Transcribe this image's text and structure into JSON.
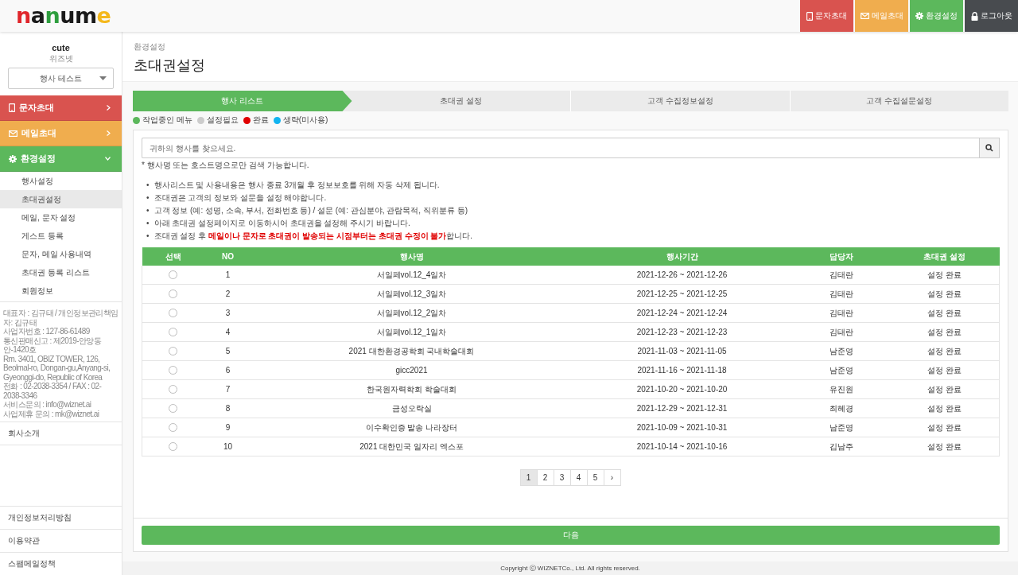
{
  "logo": {
    "letters": [
      {
        "text": "n",
        "color": "#e0262b"
      },
      {
        "text": "a",
        "color": "#1a1a1a"
      },
      {
        "text": "n",
        "color": "#2e9e3e"
      },
      {
        "text": "u",
        "color": "#1a1a1a"
      },
      {
        "text": "m",
        "color": "#1a1a1a"
      },
      {
        "text": "e",
        "color": "#f4b81c"
      }
    ]
  },
  "top_buttons": [
    {
      "label": "문자초대",
      "kind": "sms",
      "color": "#d9534f"
    },
    {
      "label": "메일초대",
      "kind": "mail",
      "color": "#f0ad4e"
    },
    {
      "label": "환경설정",
      "kind": "settings",
      "color": "#5cb85c"
    },
    {
      "label": "로그아웃",
      "kind": "logout",
      "color": "#484b4f"
    }
  ],
  "sidebar": {
    "user": "cute",
    "company": "위즈넷",
    "event_select": "행사 테스트",
    "menus": [
      {
        "label": "문자초대",
        "kind": "sms",
        "color": "#d9534f",
        "expanded": false
      },
      {
        "label": "메일초대",
        "kind": "mail",
        "color": "#f0ad4e",
        "expanded": false
      },
      {
        "label": "환경설정",
        "kind": "settings",
        "color": "#5cb85c",
        "expanded": true,
        "children": [
          {
            "label": "행사설정",
            "selected": false
          },
          {
            "label": "초대권설정",
            "selected": true
          },
          {
            "label": "메일, 문자 설정",
            "selected": false
          },
          {
            "label": "게스트 등록",
            "selected": false
          },
          {
            "label": "문자, 메일 사용내역",
            "selected": false
          },
          {
            "label": "초대권 등록 리스트",
            "selected": false
          },
          {
            "label": "회원정보",
            "selected": false
          }
        ]
      }
    ],
    "company_info": [
      "대표자 : 김규태 / 개인정보관리책임자: 김규태",
      "사업자번호 : 127-86-61489",
      "통신판매신고 : 제2019-안양동안-1420호",
      "Rm. 3401, OBIZ TOWER, 126, Beolmal-ro, Dongan-gu,Anyang-si, Gyeonggi-do, Republic of Korea",
      "전화 : 02-2038-3354 / FAX : 02-2038-3346",
      "서비스문의 : info@wiznet.ai",
      "사업제휴 문의 : mk@wiznet.ai"
    ],
    "links_top": [
      "회사소개"
    ],
    "links_bottom": [
      "개인정보처리방침",
      "이용약관",
      "스팸메일정책"
    ]
  },
  "breadcrumb": "환경설정",
  "title": "초대권설정",
  "steps": [
    {
      "label": "행사 리스트",
      "selected": true
    },
    {
      "label": "초대권 설정",
      "selected": false
    },
    {
      "label": "고객 수집정보설정",
      "selected": false
    },
    {
      "label": "고객 수집설문설정",
      "selected": false
    }
  ],
  "legend": [
    {
      "label": "작업중인 메뉴",
      "color": "#5cb85c"
    },
    {
      "label": "설정필요",
      "color": "#cccccc"
    },
    {
      "label": "완료",
      "color": "#e00000"
    },
    {
      "label": "생략",
      "note": "(미사용)",
      "color": "#12b4f0"
    }
  ],
  "search": {
    "placeholder": "귀하의 행사를 찾으세요."
  },
  "search_note": "* 행사명 또는 호스트명으로만 검색 가능합니다.",
  "notes": [
    {
      "bullet": "•",
      "text": "행사리스트 및 사용내용은 행사 종료 3개월 후 정보보호를 위해 자동 삭제 됩니다."
    },
    {
      "bullet": "•",
      "text": "조대권은 고객의 정보와 설문을 설정 해야합니다."
    },
    {
      "bullet": "•",
      "text": "고객 정보 (예: 성명, 소속, 부서, 전화번호 등) / 설문 (예: 관심분야, 관람목적, 직위분류 등)"
    },
    {
      "bullet": "•",
      "text": "아래 초대권 설정페이지로 이동하시어 초대권을 설정해 주시기 바랍니다."
    },
    {
      "bullet": "•",
      "text": "조대권 설정 후 **메일이나 문자로 초대권이 발송되는 시점부터는 초대권 수정이 불가**합니다."
    }
  ],
  "table": {
    "columns": [
      "선택",
      "NO",
      "행사명",
      "행사기간",
      "담당자",
      "초대권 설정"
    ],
    "rows": [
      {
        "selected": false,
        "cells": [
          "",
          "1",
          "서일페vol.12_4일차",
          "2021-12-26 ~ 2021-12-26",
          "김태란",
          "설정 완료"
        ]
      },
      {
        "selected": false,
        "cells": [
          "",
          "2",
          "서일페vol.12_3일차",
          "2021-12-25 ~ 2021-12-25",
          "김태란",
          "설정 완료"
        ]
      },
      {
        "selected": false,
        "cells": [
          "",
          "3",
          "서일페vol.12_2일차",
          "2021-12-24 ~ 2021-12-24",
          "김태란",
          "설정 완료"
        ]
      },
      {
        "selected": false,
        "cells": [
          "",
          "4",
          "서일페vol.12_1일차",
          "2021-12-23 ~ 2021-12-23",
          "김태란",
          "설정 완료"
        ]
      },
      {
        "selected": false,
        "cells": [
          "",
          "5",
          "2021 대한환경공학회 국내학술대회",
          "2021-11-03 ~ 2021-11-05",
          "남준영",
          "설정 완료"
        ]
      },
      {
        "selected": false,
        "cells": [
          "",
          "6",
          "gicc2021",
          "2021-11-16 ~ 2021-11-18",
          "남준영",
          "설정 완료"
        ]
      },
      {
        "selected": false,
        "cells": [
          "",
          "7",
          "한국원자력학회 학술대회",
          "2021-10-20 ~ 2021-10-20",
          "유진원",
          "설정 완료"
        ]
      },
      {
        "selected": false,
        "cells": [
          "",
          "8",
          "금성오락실",
          "2021-12-29 ~ 2021-12-31",
          "최혜경",
          "설정 완료"
        ]
      },
      {
        "selected": false,
        "cells": [
          "",
          "9",
          "이수확인증 발송 나라장터",
          "2021-10-09 ~ 2021-10-31",
          "남준영",
          "설정 완료"
        ]
      },
      {
        "selected": false,
        "cells": [
          "",
          "10",
          "2021 대한민국 일자리 엑스포",
          "2021-10-14 ~ 2021-10-16",
          "김남주",
          "설정 완료"
        ]
      }
    ]
  },
  "pagination": {
    "pages": [
      {
        "label": "1",
        "selected": true
      },
      {
        "label": "2",
        "selected": false
      },
      {
        "label": "3",
        "selected": false
      },
      {
        "label": "4",
        "selected": false
      },
      {
        "label": "5",
        "selected": false
      }
    ],
    "next": "›"
  },
  "next_button": "다음",
  "footer": "Copyright ⓒ WIZNETCo., Ltd. All rights reserved."
}
